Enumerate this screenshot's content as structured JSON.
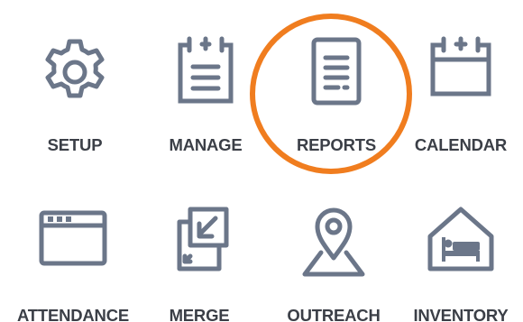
{
  "menu": {
    "items": [
      {
        "label": "SETUP",
        "icon": "gear-icon"
      },
      {
        "label": "MANAGE",
        "icon": "clipboard-list-icon"
      },
      {
        "label": "REPORTS",
        "icon": "document-icon"
      },
      {
        "label": "CALENDAR",
        "icon": "calendar-icon"
      },
      {
        "label": "ATTENDANCE",
        "icon": "browser-window-icon"
      },
      {
        "label": "MERGE",
        "icon": "merge-arrow-icon"
      },
      {
        "label": "OUTREACH",
        "icon": "map-pin-icon"
      },
      {
        "label": "INVENTORY",
        "icon": "house-bed-icon"
      }
    ],
    "highlighted": "REPORTS"
  },
  "colors": {
    "icon": "#6b7689",
    "label": "#3b3f47",
    "highlight": "#f07d1f"
  }
}
